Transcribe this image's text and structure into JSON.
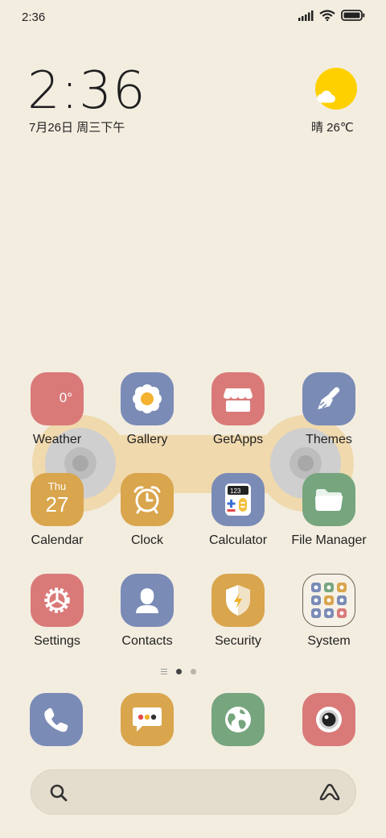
{
  "status_bar": {
    "time": "2:36",
    "icons": [
      "signal-icon",
      "wifi-icon",
      "battery-icon"
    ]
  },
  "clock_widget": {
    "time": "2:36",
    "date": "7月26日 周三下午"
  },
  "weather_widget": {
    "text": "晴 26℃",
    "icon": "sunny-cloud-icon"
  },
  "apps": [
    {
      "label": "Weather",
      "color": "#d97a79",
      "icon": "weather-icon",
      "extra": "0°"
    },
    {
      "label": "Gallery",
      "color": "#7a8bb6",
      "icon": "flower-icon"
    },
    {
      "label": "GetApps",
      "color": "#d97a79",
      "icon": "store-icon"
    },
    {
      "label": "Themes",
      "color": "#7a8bb6",
      "icon": "brush-icon"
    },
    {
      "label": "Calendar",
      "color": "#d9a54d",
      "icon": "calendar-icon",
      "day": "Thu",
      "date": "27"
    },
    {
      "label": "Clock",
      "color": "#d9a54d",
      "icon": "alarm-clock-icon"
    },
    {
      "label": "Calculator",
      "color": "#7a8bb6",
      "icon": "calculator-icon",
      "display": "123"
    },
    {
      "label": "File Manager",
      "color": "#76a57e",
      "icon": "folder-icon"
    },
    {
      "label": "Settings",
      "color": "#d97a79",
      "icon": "gear-icon"
    },
    {
      "label": "Contacts",
      "color": "#7a8bb6",
      "icon": "person-icon"
    },
    {
      "label": "Security",
      "color": "#d9a54d",
      "icon": "shield-icon"
    },
    {
      "label": "System",
      "color": "#f3ede0",
      "icon": "folder-grid-icon"
    }
  ],
  "dock": [
    {
      "name": "phone",
      "color": "#7a8bb6",
      "icon": "phone-icon"
    },
    {
      "name": "messages",
      "color": "#d9a54d",
      "icon": "message-icon"
    },
    {
      "name": "browser",
      "color": "#76a57e",
      "icon": "globe-icon"
    },
    {
      "name": "camera",
      "color": "#d97a79",
      "icon": "camera-icon"
    }
  ],
  "pager": {
    "pages": 2,
    "active": 1
  },
  "search": {
    "icon": "search-icon",
    "assistant_icon": "assistant-icon"
  }
}
